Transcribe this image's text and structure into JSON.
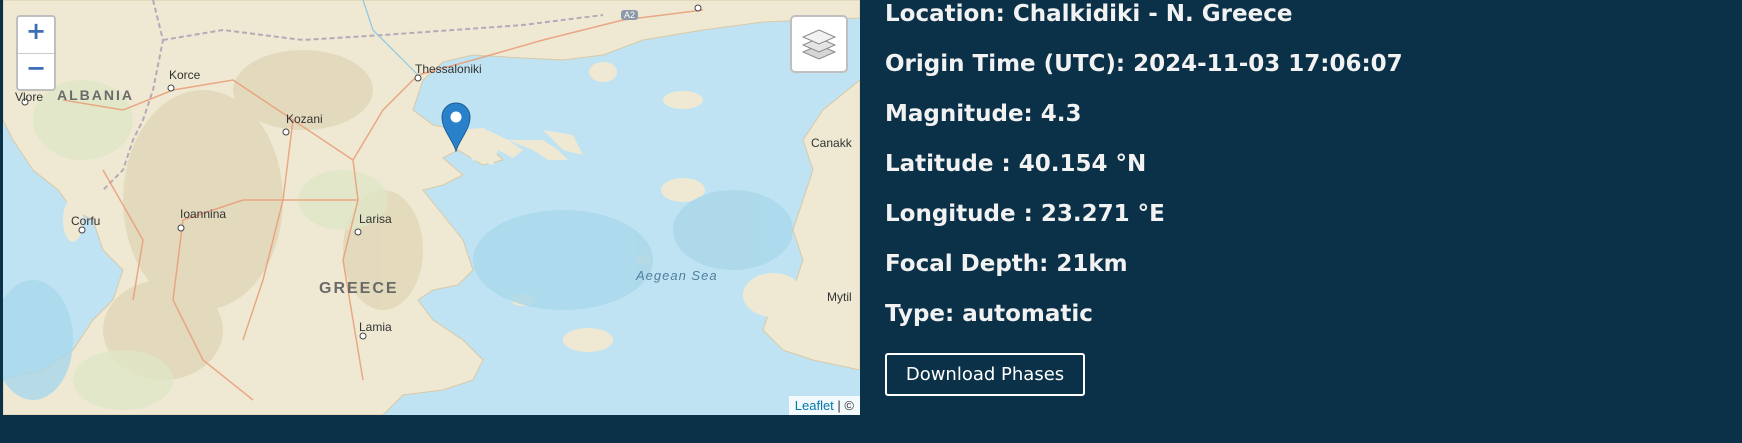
{
  "map": {
    "zoom_in": "+",
    "zoom_out": "−",
    "attribution_link": "Leaflet",
    "attribution_rest": " | ©",
    "labels": {
      "thessaloniki": "Thessaloniki",
      "korce": "Korce",
      "vlore": "Vlore",
      "albania": "ALBANIA",
      "kozani": "Kozani",
      "corfu": "Corfu",
      "ioannina": "Ioannina",
      "larisa": "Larisa",
      "greece": "GREECE",
      "lamia": "Lamia",
      "aegean": "Aegean Sea",
      "canakkale": "Canakk",
      "mytilene": "Mytil",
      "road_a2": "A2"
    },
    "colors": {
      "water": "#bfe3f2",
      "land": "#efe9d4",
      "marker": "#2a81cb"
    }
  },
  "event": {
    "location": "Location: Chalkidiki - N. Greece",
    "origin_time": "Origin Time (UTC): 2024-11-03 17:06:07",
    "magnitude": "Magnitude: 4.3",
    "latitude": "Latitude : 40.154 °N",
    "longitude": "Longitude : 23.271 °E",
    "depth": "Focal Depth: 21km",
    "type": "Type: automatic"
  },
  "download_button": "Download Phases"
}
